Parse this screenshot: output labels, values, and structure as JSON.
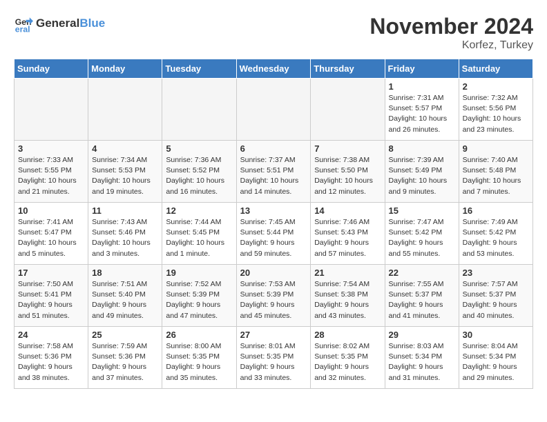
{
  "logo": {
    "general": "General",
    "blue": "Blue"
  },
  "title": {
    "month": "November 2024",
    "location": "Korfez, Turkey"
  },
  "weekdays": [
    "Sunday",
    "Monday",
    "Tuesday",
    "Wednesday",
    "Thursday",
    "Friday",
    "Saturday"
  ],
  "weeks": [
    [
      {
        "day": "",
        "empty": true
      },
      {
        "day": "",
        "empty": true
      },
      {
        "day": "",
        "empty": true
      },
      {
        "day": "",
        "empty": true
      },
      {
        "day": "",
        "empty": true
      },
      {
        "day": "1",
        "sunrise": "Sunrise: 7:31 AM",
        "sunset": "Sunset: 5:57 PM",
        "daylight": "Daylight: 10 hours and 26 minutes."
      },
      {
        "day": "2",
        "sunrise": "Sunrise: 7:32 AM",
        "sunset": "Sunset: 5:56 PM",
        "daylight": "Daylight: 10 hours and 23 minutes."
      }
    ],
    [
      {
        "day": "3",
        "sunrise": "Sunrise: 7:33 AM",
        "sunset": "Sunset: 5:55 PM",
        "daylight": "Daylight: 10 hours and 21 minutes."
      },
      {
        "day": "4",
        "sunrise": "Sunrise: 7:34 AM",
        "sunset": "Sunset: 5:53 PM",
        "daylight": "Daylight: 10 hours and 19 minutes."
      },
      {
        "day": "5",
        "sunrise": "Sunrise: 7:36 AM",
        "sunset": "Sunset: 5:52 PM",
        "daylight": "Daylight: 10 hours and 16 minutes."
      },
      {
        "day": "6",
        "sunrise": "Sunrise: 7:37 AM",
        "sunset": "Sunset: 5:51 PM",
        "daylight": "Daylight: 10 hours and 14 minutes."
      },
      {
        "day": "7",
        "sunrise": "Sunrise: 7:38 AM",
        "sunset": "Sunset: 5:50 PM",
        "daylight": "Daylight: 10 hours and 12 minutes."
      },
      {
        "day": "8",
        "sunrise": "Sunrise: 7:39 AM",
        "sunset": "Sunset: 5:49 PM",
        "daylight": "Daylight: 10 hours and 9 minutes."
      },
      {
        "day": "9",
        "sunrise": "Sunrise: 7:40 AM",
        "sunset": "Sunset: 5:48 PM",
        "daylight": "Daylight: 10 hours and 7 minutes."
      }
    ],
    [
      {
        "day": "10",
        "sunrise": "Sunrise: 7:41 AM",
        "sunset": "Sunset: 5:47 PM",
        "daylight": "Daylight: 10 hours and 5 minutes."
      },
      {
        "day": "11",
        "sunrise": "Sunrise: 7:43 AM",
        "sunset": "Sunset: 5:46 PM",
        "daylight": "Daylight: 10 hours and 3 minutes."
      },
      {
        "day": "12",
        "sunrise": "Sunrise: 7:44 AM",
        "sunset": "Sunset: 5:45 PM",
        "daylight": "Daylight: 10 hours and 1 minute."
      },
      {
        "day": "13",
        "sunrise": "Sunrise: 7:45 AM",
        "sunset": "Sunset: 5:44 PM",
        "daylight": "Daylight: 9 hours and 59 minutes."
      },
      {
        "day": "14",
        "sunrise": "Sunrise: 7:46 AM",
        "sunset": "Sunset: 5:43 PM",
        "daylight": "Daylight: 9 hours and 57 minutes."
      },
      {
        "day": "15",
        "sunrise": "Sunrise: 7:47 AM",
        "sunset": "Sunset: 5:42 PM",
        "daylight": "Daylight: 9 hours and 55 minutes."
      },
      {
        "day": "16",
        "sunrise": "Sunrise: 7:49 AM",
        "sunset": "Sunset: 5:42 PM",
        "daylight": "Daylight: 9 hours and 53 minutes."
      }
    ],
    [
      {
        "day": "17",
        "sunrise": "Sunrise: 7:50 AM",
        "sunset": "Sunset: 5:41 PM",
        "daylight": "Daylight: 9 hours and 51 minutes."
      },
      {
        "day": "18",
        "sunrise": "Sunrise: 7:51 AM",
        "sunset": "Sunset: 5:40 PM",
        "daylight": "Daylight: 9 hours and 49 minutes."
      },
      {
        "day": "19",
        "sunrise": "Sunrise: 7:52 AM",
        "sunset": "Sunset: 5:39 PM",
        "daylight": "Daylight: 9 hours and 47 minutes."
      },
      {
        "day": "20",
        "sunrise": "Sunrise: 7:53 AM",
        "sunset": "Sunset: 5:39 PM",
        "daylight": "Daylight: 9 hours and 45 minutes."
      },
      {
        "day": "21",
        "sunrise": "Sunrise: 7:54 AM",
        "sunset": "Sunset: 5:38 PM",
        "daylight": "Daylight: 9 hours and 43 minutes."
      },
      {
        "day": "22",
        "sunrise": "Sunrise: 7:55 AM",
        "sunset": "Sunset: 5:37 PM",
        "daylight": "Daylight: 9 hours and 41 minutes."
      },
      {
        "day": "23",
        "sunrise": "Sunrise: 7:57 AM",
        "sunset": "Sunset: 5:37 PM",
        "daylight": "Daylight: 9 hours and 40 minutes."
      }
    ],
    [
      {
        "day": "24",
        "sunrise": "Sunrise: 7:58 AM",
        "sunset": "Sunset: 5:36 PM",
        "daylight": "Daylight: 9 hours and 38 minutes."
      },
      {
        "day": "25",
        "sunrise": "Sunrise: 7:59 AM",
        "sunset": "Sunset: 5:36 PM",
        "daylight": "Daylight: 9 hours and 37 minutes."
      },
      {
        "day": "26",
        "sunrise": "Sunrise: 8:00 AM",
        "sunset": "Sunset: 5:35 PM",
        "daylight": "Daylight: 9 hours and 35 minutes."
      },
      {
        "day": "27",
        "sunrise": "Sunrise: 8:01 AM",
        "sunset": "Sunset: 5:35 PM",
        "daylight": "Daylight: 9 hours and 33 minutes."
      },
      {
        "day": "28",
        "sunrise": "Sunrise: 8:02 AM",
        "sunset": "Sunset: 5:35 PM",
        "daylight": "Daylight: 9 hours and 32 minutes."
      },
      {
        "day": "29",
        "sunrise": "Sunrise: 8:03 AM",
        "sunset": "Sunset: 5:34 PM",
        "daylight": "Daylight: 9 hours and 31 minutes."
      },
      {
        "day": "30",
        "sunrise": "Sunrise: 8:04 AM",
        "sunset": "Sunset: 5:34 PM",
        "daylight": "Daylight: 9 hours and 29 minutes."
      }
    ]
  ]
}
